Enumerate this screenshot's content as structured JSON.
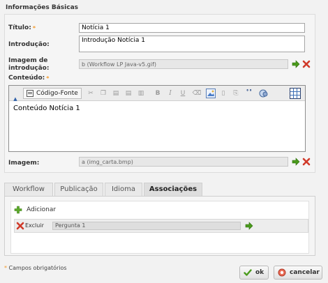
{
  "section": {
    "title": "Informações Básicas"
  },
  "required_mark": "*",
  "fields": {
    "titulo": {
      "label": "Título:",
      "value": "Notícia 1"
    },
    "introducao": {
      "label": "Introdução:",
      "value": "Introdução Notícia 1"
    },
    "imagem_introducao": {
      "label": "Imagem de introdução:",
      "value": "b (Workflow LP Java-v5.gif)"
    },
    "conteudo": {
      "label": "Conteúdo:",
      "source_button": "Código-Fonte",
      "value": "Conteúdo Notícia 1"
    },
    "imagem": {
      "label": "Imagem:",
      "value": "a (img_carta.bmp)"
    }
  },
  "tabs": [
    {
      "label": "Workflow"
    },
    {
      "label": "Publicação"
    },
    {
      "label": "Idioma"
    },
    {
      "label": "Associações",
      "active": true
    }
  ],
  "associations": {
    "add_label": "Adicionar",
    "remove_label": "Excluir",
    "item_value": "Pergunta 1"
  },
  "footer": {
    "required_note": "Campos obrigatórios",
    "ok_label": "ok",
    "cancel_label": "cancelar"
  },
  "colors": {
    "required": "#f39a2c",
    "go_arrow": "#4a9a1c",
    "remove_x": "#d03a2a"
  }
}
